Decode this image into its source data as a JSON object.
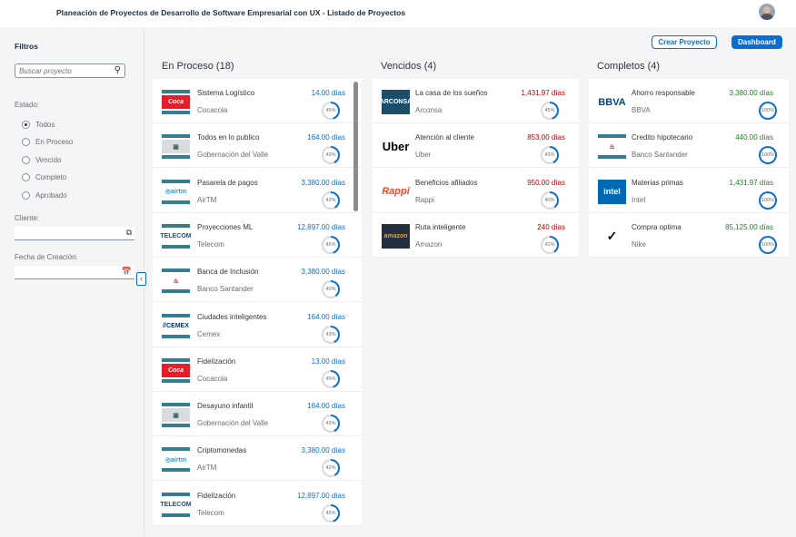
{
  "app": {
    "title": "Planeación de Proyectos de Desarrollo de Software Empresarial con UX - Listado de Proyectos"
  },
  "actions": {
    "create": "Crear Proyecto",
    "dashboard": "Dashboard"
  },
  "filters": {
    "title": "Filtros",
    "search_placeholder": "Buscar proyecto",
    "estado_label": "Estado:",
    "estado_options": [
      "Todos",
      "En Proceso",
      "Vencido",
      "Completo",
      "Aprobado"
    ],
    "estado_selected": "Todos",
    "cliente_label": "Cliente:",
    "fecha_label": "Fecha de Creación:"
  },
  "columns": [
    {
      "title": "En Proceso (18)",
      "days_color": "#0a6ed1",
      "items": [
        {
          "name": "Sistema Logístico",
          "client": "Cocacola",
          "days": "14.00 días",
          "pct": "45%",
          "progress": 45,
          "logo": "cocacola"
        },
        {
          "name": "Todos en lo publico",
          "client": "Gobernación del Valle",
          "days": "164.00 días",
          "pct": "43%",
          "progress": 43,
          "logo": "gobernacion"
        },
        {
          "name": "Pasarela de pagos",
          "client": "AirTM",
          "days": "3,380.00 días",
          "pct": "42%",
          "progress": 42,
          "logo": "airtm"
        },
        {
          "name": "Proyecciones ML",
          "client": "Telecom",
          "days": "12,897.00 días",
          "pct": "45%",
          "progress": 45,
          "logo": "telecom"
        },
        {
          "name": "Banca de Inclusión",
          "client": "Banco Santander",
          "days": "3,380.00 días",
          "pct": "40%",
          "progress": 40,
          "logo": "santander"
        },
        {
          "name": "Ciudades inteligentes",
          "client": "Cemex",
          "days": "164.00 días",
          "pct": "43%",
          "progress": 43,
          "logo": "cemex"
        },
        {
          "name": "Fidelización",
          "client": "Cocacola",
          "days": "13.00 días",
          "pct": "45%",
          "progress": 45,
          "logo": "cocacola"
        },
        {
          "name": "Desayuno infantil",
          "client": "Gobernación del Valle",
          "days": "164.00 días",
          "pct": "43%",
          "progress": 43,
          "logo": "gobernacion"
        },
        {
          "name": "Criptomonedas",
          "client": "AirTM",
          "days": "3,380.00 días",
          "pct": "42%",
          "progress": 42,
          "logo": "airtm"
        },
        {
          "name": "Fidelización",
          "client": "Telecom",
          "days": "12,897.00 días",
          "pct": "45%",
          "progress": 45,
          "logo": "telecom"
        }
      ]
    },
    {
      "title": "Vencidos (4)",
      "days_color": "#bb0000",
      "items": [
        {
          "name": "La casa de los sueños",
          "client": "Arconsa",
          "days": "1,431.97 días",
          "pct": "45%",
          "progress": 45,
          "logo": "arconsa"
        },
        {
          "name": "Atención al cliente",
          "client": "Uber",
          "days": "853.00 días",
          "pct": "43%",
          "progress": 43,
          "logo": "uber"
        },
        {
          "name": "Beneficios afiliados",
          "client": "Rappi",
          "days": "950.00 días",
          "pct": "40%",
          "progress": 40,
          "logo": "rappi"
        },
        {
          "name": "Ruta inteligente",
          "client": "Amazon",
          "days": "240 días",
          "pct": "41%",
          "progress": 41,
          "logo": "amazon"
        }
      ]
    },
    {
      "title": "Completos (4)",
      "days_color": "#2b7c2b",
      "items": [
        {
          "name": "Ahorro responsable",
          "client": "BBVA",
          "days": "3,380.00 días",
          "pct": "100%",
          "progress": 100,
          "logo": "bbva"
        },
        {
          "name": "Credito hipotecario",
          "client": "Banco Santander",
          "days": "440.00 días",
          "pct": "100%",
          "progress": 100,
          "logo": "santander"
        },
        {
          "name": "Materias primas",
          "client": "Intel",
          "days": "1,431.97 días",
          "pct": "100%",
          "progress": 100,
          "logo": "intel"
        },
        {
          "name": "Compra optima",
          "client": "Nike",
          "days": "85,125.00 días",
          "pct": "100%",
          "progress": 100,
          "logo": "nike"
        }
      ]
    }
  ]
}
